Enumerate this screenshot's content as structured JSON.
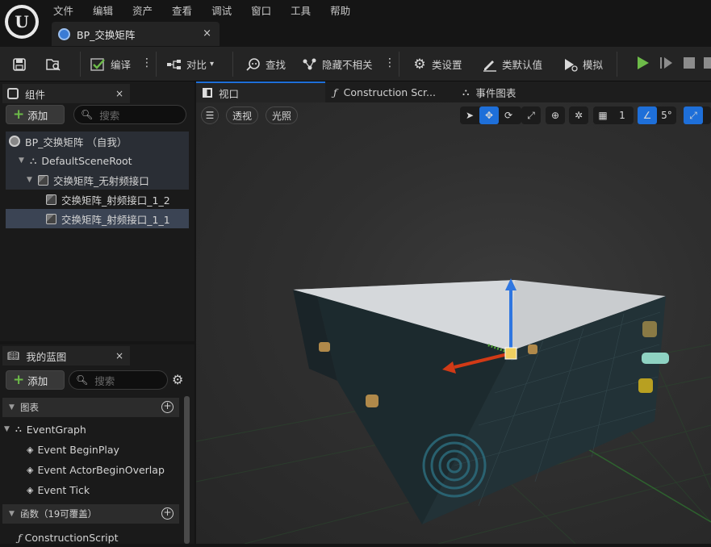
{
  "menu": [
    "文件",
    "编辑",
    "资产",
    "查看",
    "调试",
    "窗口",
    "工具",
    "帮助"
  ],
  "doc_tab": {
    "title": "BP_交换矩阵",
    "close": "×"
  },
  "toolbar": {
    "compile": "编译",
    "diff": "对比",
    "find": "查找",
    "hide_unrelated": "隐藏不相关",
    "class_settings": "类设置",
    "class_defaults": "类默认值",
    "simulate": "模拟"
  },
  "components": {
    "tab_title": "组件",
    "close": "×",
    "add_label": "添加",
    "search_placeholder": "搜索",
    "tree": [
      {
        "label": "BP_交换矩阵 （自我）"
      },
      {
        "label": "DefaultSceneRoot"
      },
      {
        "label": "交换矩阵_无射频接口"
      },
      {
        "label": "交换矩阵_射频接口_1_2"
      },
      {
        "label": "交换矩阵_射频接口_1_1"
      }
    ]
  },
  "my_blueprint": {
    "tab_title": "我的蓝图",
    "close": "×",
    "add_label": "添加",
    "search_placeholder": "搜索",
    "section_graphs": "图表",
    "event_graph": "EventGraph",
    "events": [
      "Event BeginPlay",
      "Event ActorBeginOverlap",
      "Event Tick"
    ],
    "section_functions": "函数（19可覆盖）",
    "construction_script": "ConstructionScript"
  },
  "viewport_tabs": [
    {
      "label": "视口"
    },
    {
      "label": "Construction Scr..."
    },
    {
      "label": "事件图表"
    }
  ],
  "viewport": {
    "perspective": "透视",
    "lighting": "光照",
    "grid_size": "1",
    "rotation_snap": "5°"
  },
  "colors": {
    "accent": "#1e6fd9",
    "add_green": "#6dbb49",
    "play_green": "#6dbb49"
  }
}
